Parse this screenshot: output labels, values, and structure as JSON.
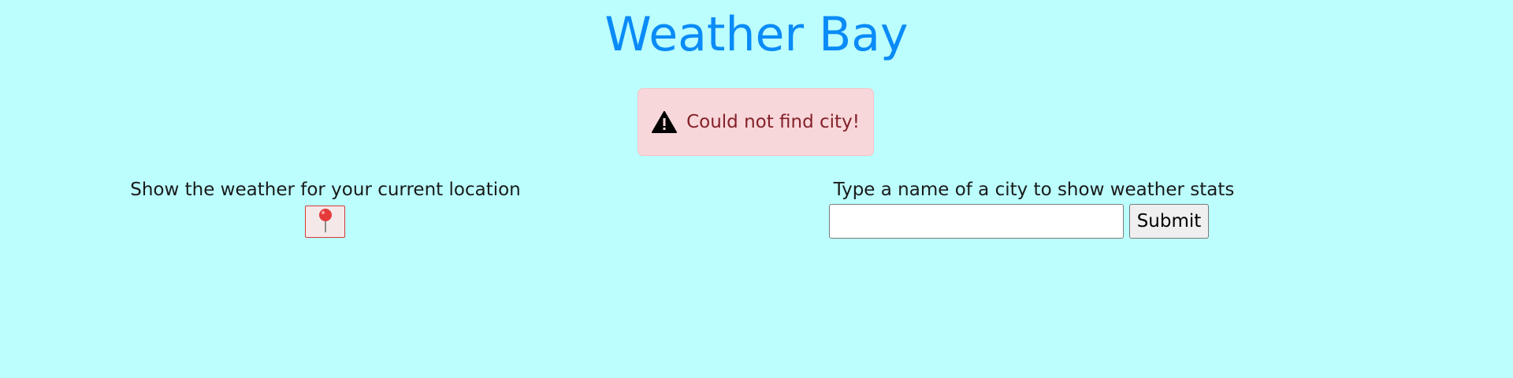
{
  "header": {
    "title": "Weather Bay",
    "title_color": "#0a8bf7"
  },
  "alert": {
    "icon": "warning-icon",
    "message": "Could not find city!",
    "bg_color": "#f8d7da",
    "text_color": "#842029"
  },
  "location": {
    "caption": "Show the weather for your current location",
    "button_icon": "map-pin-icon"
  },
  "search": {
    "caption": "Type a name of a city to show weather stats",
    "value": "",
    "placeholder": "",
    "submit_label": "Submit"
  },
  "colors": {
    "background": "#bbfefd"
  }
}
